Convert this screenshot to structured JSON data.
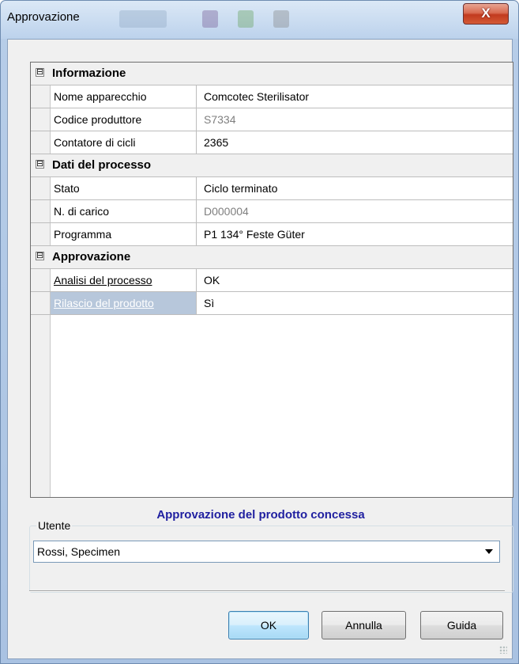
{
  "window": {
    "title": "Approvazione",
    "close_label": "X",
    "close_icon": "close-icon"
  },
  "property_grid": {
    "categories": [
      {
        "label": "Informazione",
        "expander": "⊟",
        "rows": [
          {
            "name": "Nome apparecchio",
            "value": "Comcotec Sterilisator"
          },
          {
            "name": "Codice produttore",
            "value": "S7334"
          },
          {
            "name": "Contatore di cicli",
            "value": "2365"
          }
        ]
      },
      {
        "label": "Dati del processo",
        "expander": "⊟",
        "rows": [
          {
            "name": "Stato",
            "value": "Ciclo terminato"
          },
          {
            "name": "N. di carico",
            "value": "D000004"
          },
          {
            "name": "Programma",
            "value": "P1 134° Feste Güter"
          }
        ]
      },
      {
        "label": "Approvazione",
        "expander": "⊟",
        "rows": [
          {
            "name": "Analisi del processo",
            "value": "OK"
          },
          {
            "name": "Rilascio del prodotto",
            "value": "Sì"
          }
        ]
      }
    ]
  },
  "status_message": "Approvazione del prodotto concessa",
  "user_group": {
    "label": "Utente",
    "selected": "Rossi, Specimen",
    "arrow_icon": "chevron-down-icon"
  },
  "buttons": {
    "ok": "OK",
    "cancel": "Annulla",
    "help": "Guida"
  },
  "colors": {
    "status_text": "#1f1fa0",
    "selected_row": "#b7c7db",
    "readonly_value": "#7f7f7f"
  }
}
